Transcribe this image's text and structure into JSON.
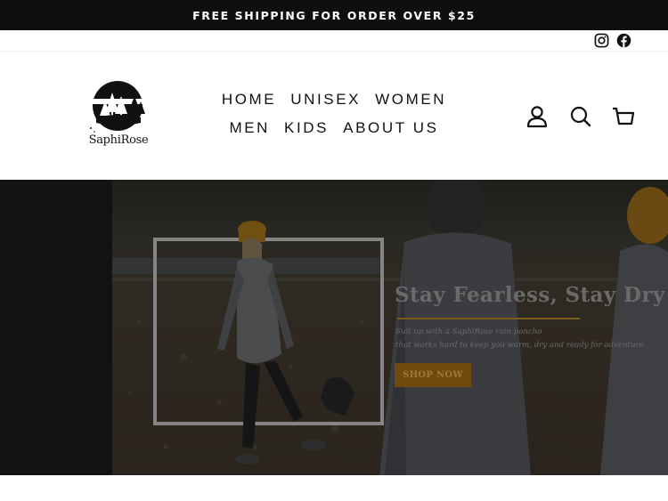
{
  "announcement": {
    "text": "FREE SHIPPING FOR ORDER OVER $25"
  },
  "social": {
    "icons": [
      "instagram-icon",
      "facebook-icon"
    ]
  },
  "logo": {
    "text": "SaphiRose"
  },
  "nav": {
    "row1": [
      "HOME",
      "UNISEX",
      "WOMEN"
    ],
    "row2": [
      "MEN",
      "KIDS",
      "ABOUT US"
    ]
  },
  "header_icons": [
    "account-icon",
    "search-icon",
    "cart-icon"
  ],
  "hero": {
    "title": "Stay Fearless,  Stay Dry",
    "subtitle_line1": "Suit up with a SaphiRose rain poncho",
    "subtitle_line2": "that works hard to keep you warm, dry and ready for adventure",
    "cta": "SHOP NOW"
  },
  "colors": {
    "announcement_bg": "#0f0f0f",
    "text": "#111111",
    "accent_gold": "#6e4a0f",
    "hero_text": "#6a6a6a"
  }
}
